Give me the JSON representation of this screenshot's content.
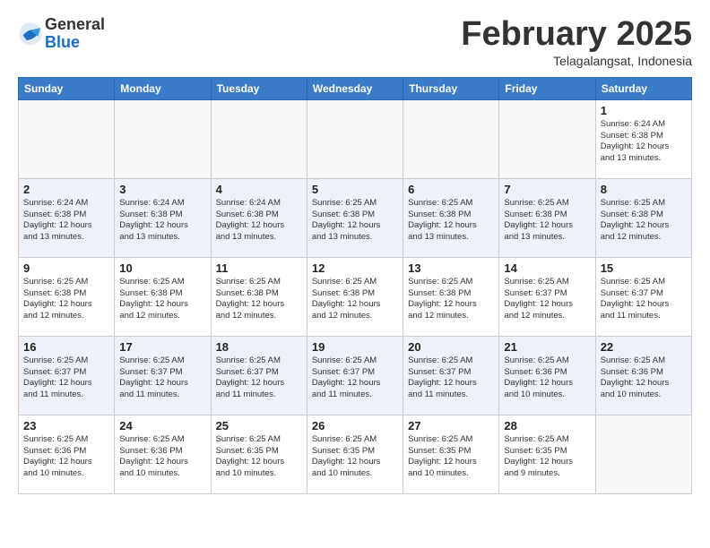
{
  "header": {
    "logo_general": "General",
    "logo_blue": "Blue",
    "month": "February 2025",
    "location": "Telagalangsat, Indonesia"
  },
  "weekdays": [
    "Sunday",
    "Monday",
    "Tuesday",
    "Wednesday",
    "Thursday",
    "Friday",
    "Saturday"
  ],
  "weeks": [
    [
      {
        "day": "",
        "info": ""
      },
      {
        "day": "",
        "info": ""
      },
      {
        "day": "",
        "info": ""
      },
      {
        "day": "",
        "info": ""
      },
      {
        "day": "",
        "info": ""
      },
      {
        "day": "",
        "info": ""
      },
      {
        "day": "1",
        "info": "Sunrise: 6:24 AM\nSunset: 6:38 PM\nDaylight: 12 hours\nand 13 minutes."
      }
    ],
    [
      {
        "day": "2",
        "info": "Sunrise: 6:24 AM\nSunset: 6:38 PM\nDaylight: 12 hours\nand 13 minutes."
      },
      {
        "day": "3",
        "info": "Sunrise: 6:24 AM\nSunset: 6:38 PM\nDaylight: 12 hours\nand 13 minutes."
      },
      {
        "day": "4",
        "info": "Sunrise: 6:24 AM\nSunset: 6:38 PM\nDaylight: 12 hours\nand 13 minutes."
      },
      {
        "day": "5",
        "info": "Sunrise: 6:25 AM\nSunset: 6:38 PM\nDaylight: 12 hours\nand 13 minutes."
      },
      {
        "day": "6",
        "info": "Sunrise: 6:25 AM\nSunset: 6:38 PM\nDaylight: 12 hours\nand 13 minutes."
      },
      {
        "day": "7",
        "info": "Sunrise: 6:25 AM\nSunset: 6:38 PM\nDaylight: 12 hours\nand 13 minutes."
      },
      {
        "day": "8",
        "info": "Sunrise: 6:25 AM\nSunset: 6:38 PM\nDaylight: 12 hours\nand 12 minutes."
      }
    ],
    [
      {
        "day": "9",
        "info": "Sunrise: 6:25 AM\nSunset: 6:38 PM\nDaylight: 12 hours\nand 12 minutes."
      },
      {
        "day": "10",
        "info": "Sunrise: 6:25 AM\nSunset: 6:38 PM\nDaylight: 12 hours\nand 12 minutes."
      },
      {
        "day": "11",
        "info": "Sunrise: 6:25 AM\nSunset: 6:38 PM\nDaylight: 12 hours\nand 12 minutes."
      },
      {
        "day": "12",
        "info": "Sunrise: 6:25 AM\nSunset: 6:38 PM\nDaylight: 12 hours\nand 12 minutes."
      },
      {
        "day": "13",
        "info": "Sunrise: 6:25 AM\nSunset: 6:38 PM\nDaylight: 12 hours\nand 12 minutes."
      },
      {
        "day": "14",
        "info": "Sunrise: 6:25 AM\nSunset: 6:37 PM\nDaylight: 12 hours\nand 12 minutes."
      },
      {
        "day": "15",
        "info": "Sunrise: 6:25 AM\nSunset: 6:37 PM\nDaylight: 12 hours\nand 11 minutes."
      }
    ],
    [
      {
        "day": "16",
        "info": "Sunrise: 6:25 AM\nSunset: 6:37 PM\nDaylight: 12 hours\nand 11 minutes."
      },
      {
        "day": "17",
        "info": "Sunrise: 6:25 AM\nSunset: 6:37 PM\nDaylight: 12 hours\nand 11 minutes."
      },
      {
        "day": "18",
        "info": "Sunrise: 6:25 AM\nSunset: 6:37 PM\nDaylight: 12 hours\nand 11 minutes."
      },
      {
        "day": "19",
        "info": "Sunrise: 6:25 AM\nSunset: 6:37 PM\nDaylight: 12 hours\nand 11 minutes."
      },
      {
        "day": "20",
        "info": "Sunrise: 6:25 AM\nSunset: 6:37 PM\nDaylight: 12 hours\nand 11 minutes."
      },
      {
        "day": "21",
        "info": "Sunrise: 6:25 AM\nSunset: 6:36 PM\nDaylight: 12 hours\nand 10 minutes."
      },
      {
        "day": "22",
        "info": "Sunrise: 6:25 AM\nSunset: 6:36 PM\nDaylight: 12 hours\nand 10 minutes."
      }
    ],
    [
      {
        "day": "23",
        "info": "Sunrise: 6:25 AM\nSunset: 6:36 PM\nDaylight: 12 hours\nand 10 minutes."
      },
      {
        "day": "24",
        "info": "Sunrise: 6:25 AM\nSunset: 6:36 PM\nDaylight: 12 hours\nand 10 minutes."
      },
      {
        "day": "25",
        "info": "Sunrise: 6:25 AM\nSunset: 6:35 PM\nDaylight: 12 hours\nand 10 minutes."
      },
      {
        "day": "26",
        "info": "Sunrise: 6:25 AM\nSunset: 6:35 PM\nDaylight: 12 hours\nand 10 minutes."
      },
      {
        "day": "27",
        "info": "Sunrise: 6:25 AM\nSunset: 6:35 PM\nDaylight: 12 hours\nand 10 minutes."
      },
      {
        "day": "28",
        "info": "Sunrise: 6:25 AM\nSunset: 6:35 PM\nDaylight: 12 hours\nand 9 minutes."
      },
      {
        "day": "",
        "info": ""
      }
    ]
  ]
}
